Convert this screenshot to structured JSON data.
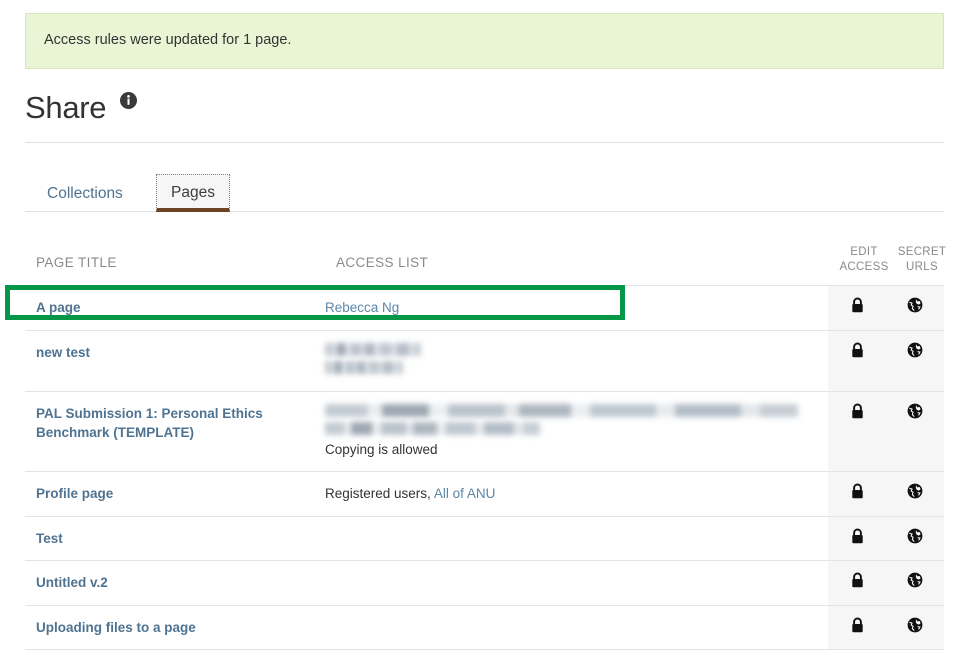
{
  "alert": {
    "message": "Access rules were updated for 1 page."
  },
  "header": {
    "title": "Share",
    "info_icon": "info-icon"
  },
  "tabs": [
    {
      "label": "Collections",
      "active": false
    },
    {
      "label": "Pages",
      "active": true
    }
  ],
  "table": {
    "columns": {
      "page_title": "PAGE TITLE",
      "access_list": "ACCESS LIST",
      "edit_access_line1": "EDIT",
      "edit_access_line2": "ACCESS",
      "secret_urls_line1": "SECRET",
      "secret_urls_line2": "URLS"
    },
    "icons": {
      "edit_access": "lock-icon",
      "secret_urls": "globe-icon"
    },
    "rows": [
      {
        "title": "A page",
        "access_plain": "",
        "access_link": "Rebecca Ng",
        "note": "",
        "redacted": false,
        "highlighted": true
      },
      {
        "title": "new test",
        "access_plain": "",
        "access_link": "",
        "note": "",
        "redacted": true,
        "highlighted": false
      },
      {
        "title": "PAL Submission 1: Personal Ethics Benchmark (TEMPLATE)",
        "access_plain": "",
        "access_link": "",
        "note": "Copying is allowed",
        "redacted": true,
        "highlighted": false
      },
      {
        "title": "Profile page",
        "access_plain": "Registered users, ",
        "access_link": "All of ANU",
        "note": "",
        "redacted": false,
        "highlighted": false
      },
      {
        "title": "Test",
        "access_plain": "",
        "access_link": "",
        "note": "",
        "redacted": false,
        "highlighted": false
      },
      {
        "title": "Untitled v.2",
        "access_plain": "",
        "access_link": "",
        "note": "",
        "redacted": false,
        "highlighted": false
      },
      {
        "title": "Uploading files to a page",
        "access_plain": "",
        "access_link": "",
        "note": "",
        "redacted": false,
        "highlighted": false
      }
    ]
  },
  "colors": {
    "alert_bg": "#eaf5d5",
    "alert_border": "#d7e8b8",
    "link": "#4f7390",
    "link_soft": "#5b87a8",
    "tab_active_underline": "#6b4421",
    "highlight": "#059748",
    "icon_cell_bg": "#f6f6f6"
  }
}
